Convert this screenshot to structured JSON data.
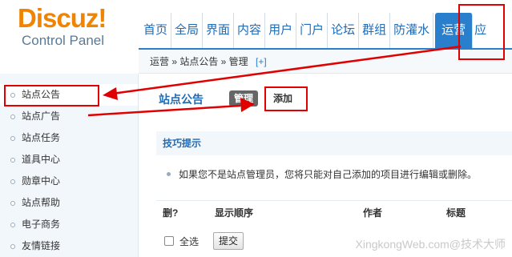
{
  "logo": {
    "brand": "Discuz!",
    "subtitle": "Control Panel"
  },
  "topnav": {
    "items": [
      "首页",
      "全局",
      "界面",
      "内容",
      "用户",
      "门户",
      "论坛",
      "群组",
      "防灌水"
    ],
    "active": "运营",
    "cut": "应"
  },
  "breadcrumb": {
    "text": "运营 » 站点公告 » 管理",
    "plus": "[+]"
  },
  "sidebar": {
    "items": [
      "站点公告",
      "站点广告",
      "站点任务",
      "道具中心",
      "勋章中心",
      "站点帮助",
      "电子商务",
      "友情链接"
    ]
  },
  "main": {
    "title": "站点公告",
    "tab_manage": "管理",
    "tab_add": "添加",
    "tips_title": "技巧提示",
    "tip_text": "如果您不是站点管理员，您将只能对自己添加的项目进行编辑或删除。",
    "columns": [
      "删?",
      "显示顺序",
      "作者",
      "标题"
    ],
    "select_all": "全选",
    "submit": "提交"
  },
  "watermark": "XingkongWeb.com@技术大师",
  "colors": {
    "accent": "#2a7fcc",
    "brand": "#f08300",
    "annotation": "#e00000"
  }
}
